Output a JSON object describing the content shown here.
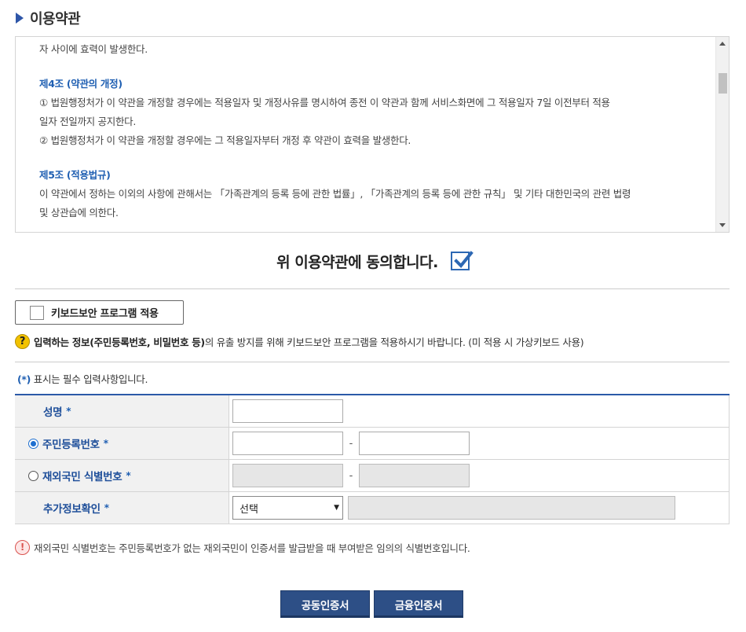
{
  "section": {
    "title": "이용약관"
  },
  "terms": {
    "line1": "자 사이에 효력이 발생한다.",
    "art4_head": "제4조 (약관의 개정)",
    "art4_p1a": "① 법원행정처가 이 약관을 개정할 경우에는 적용일자 및 개정사유를 명시하여 종전 이 약관과 함께 서비스화면에 그 적용일자 7일 이전부터 적용",
    "art4_p1b": "일자 전일까지 공지한다.",
    "art4_p2": "② 법원행정처가 이 약관을 개정할 경우에는 그 적용일자부터 개정 후 약관이 효력을 발생한다.",
    "art5_head": "제5조 (적용법규)",
    "art5_p1a": "이 약관에서 정하는 이외의 사항에 관해서는 「가족관계의 등록 등에 관한 법률」, 「가족관계의 등록 등에 관한 규칙」 및 기타 대한민국의 관련 법령",
    "art5_p1b": "및 상관습에 의한다."
  },
  "agree": {
    "label": "위 이용약관에 동의합니다.",
    "checked": true
  },
  "keyboard": {
    "label": "키보드보안 프로그램 적용"
  },
  "help": {
    "icon": "?",
    "bold": "입력하는 정보(주민등록번호, 비밀번호 등)",
    "rest": "의 유출 방지를 위해 키보드보안 프로그램을 적용하시기 바랍니다. (미 적용 시 가상키보드 사용)"
  },
  "required_note": {
    "star": "(*)",
    "text": " 표시는 필수 입력사항입니다."
  },
  "form": {
    "name_label": "성명",
    "rrn_label": "주민등록번호",
    "foreign_label": "재외국민 식별번호",
    "extra_label": "추가정보확인",
    "star": "*",
    "dash": "-",
    "select_value": "선택"
  },
  "warning": {
    "icon": "!",
    "text": "재외국민 식별번호는 주민등록번호가 없는 재외국민이 인증서를 발급받을 때 부여받은 임의의 식별번호입니다."
  },
  "buttons": {
    "joint_cert": "공동인증서",
    "financial_cert": "금융인증서"
  }
}
